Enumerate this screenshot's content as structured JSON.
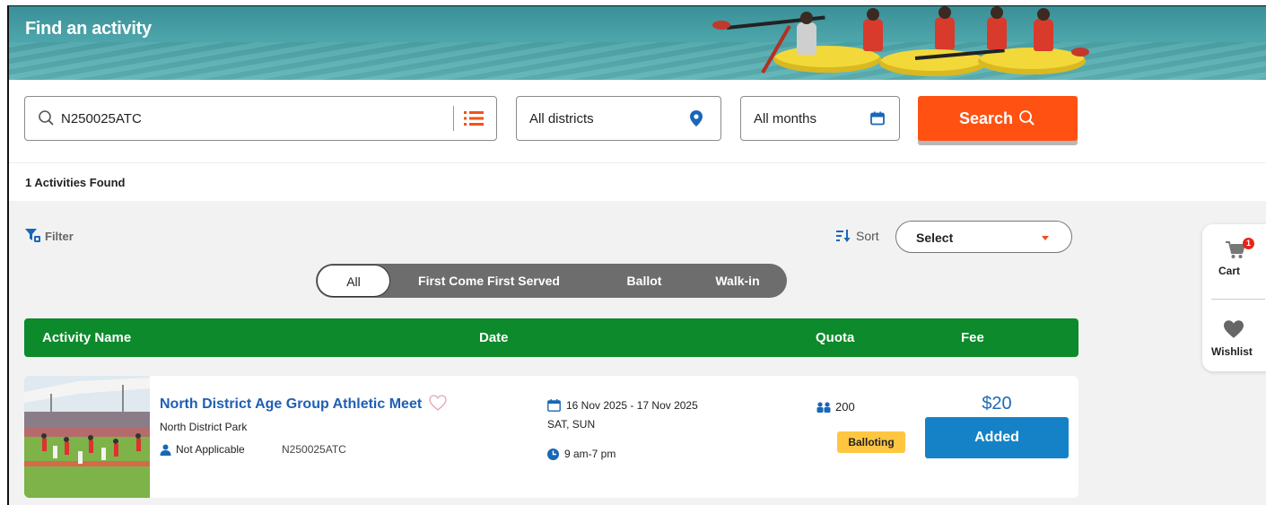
{
  "banner": {
    "title": "Find an activity"
  },
  "search": {
    "keyword_value": "N250025ATC",
    "district_value": "All districts",
    "month_value": "All months",
    "search_label": "Search"
  },
  "results": {
    "found_text": "1 Activities Found"
  },
  "toolbar": {
    "filter_label": "Filter",
    "sort_label": "Sort",
    "sort_select_value": "Select"
  },
  "tabs": [
    {
      "label": "All",
      "active": true
    },
    {
      "label": "First Come First Served",
      "active": false
    },
    {
      "label": "Ballot",
      "active": false
    },
    {
      "label": "Walk-in",
      "active": false
    }
  ],
  "table": {
    "headers": {
      "name": "Activity Name",
      "date": "Date",
      "quota": "Quota",
      "fee": "Fee"
    },
    "rows": [
      {
        "title": "North District Age Group Athletic Meet",
        "location": "North District Park",
        "target": "Not Applicable",
        "code": "N250025ATC",
        "date_range": "16 Nov 2025 - 17 Nov 2025",
        "days": "SAT, SUN",
        "time": "9 am-7 pm",
        "quota": "200",
        "status": "Balloting",
        "fee": "$20",
        "action_label": "Added"
      }
    ]
  },
  "side_panel": {
    "cart_label": "Cart",
    "cart_count": "1",
    "wishlist_label": "Wishlist"
  },
  "colors": {
    "accent_orange": "#ff5212",
    "header_green": "#0d8a2b",
    "link_blue": "#1f5fb4",
    "button_blue": "#1582c7",
    "status_yellow": "#ffc641"
  }
}
